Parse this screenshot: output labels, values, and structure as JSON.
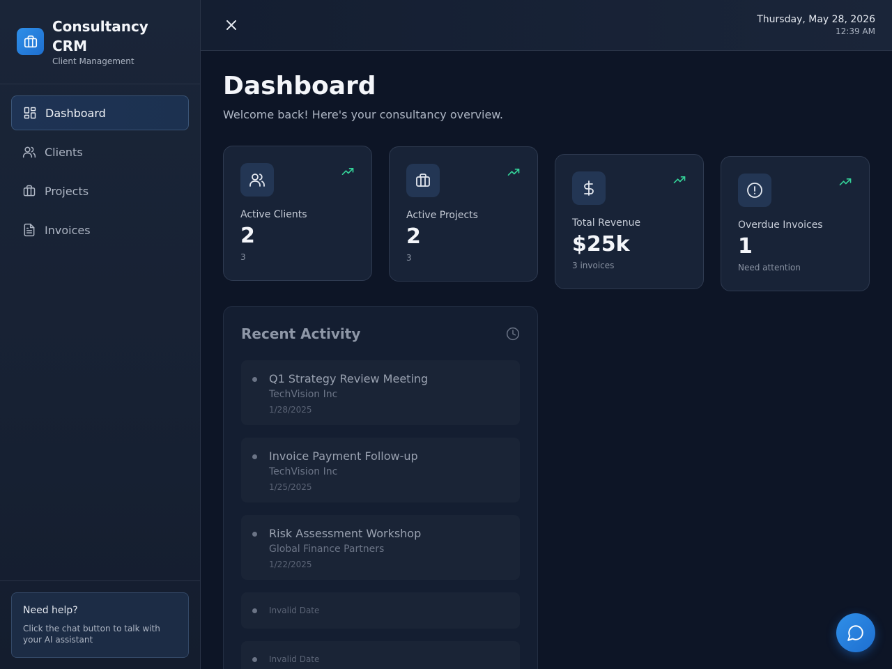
{
  "app": {
    "title": "Consultancy CRM",
    "subtitle": "Client Management",
    "logo_icon": "briefcase-icon"
  },
  "sidebar": {
    "items": [
      {
        "label": "Dashboard",
        "icon": "dashboard-grid-icon",
        "active": true
      },
      {
        "label": "Clients",
        "icon": "users-icon",
        "active": false
      },
      {
        "label": "Projects",
        "icon": "briefcase-icon",
        "active": false
      },
      {
        "label": "Invoices",
        "icon": "file-text-icon",
        "active": false
      }
    ],
    "help": {
      "title": "Need help?",
      "text": "Click the chat button to talk with your AI assistant"
    }
  },
  "header": {
    "date": "Thursday, May 28, 2026",
    "time": "12:39 AM"
  },
  "main": {
    "title": "Dashboard",
    "subtitle": "Welcome back! Here's your consultancy overview.",
    "stats": [
      {
        "label": "Active Clients",
        "value": "2",
        "sub": "3",
        "icon": "users-icon"
      },
      {
        "label": "Active Projects",
        "value": "2",
        "sub": "3",
        "icon": "briefcase-icon"
      },
      {
        "label": "Total Revenue",
        "value": "$25k",
        "sub": "3 invoices",
        "icon": "dollar-icon"
      },
      {
        "label": "Overdue Invoices",
        "value": "1",
        "sub": "Need attention",
        "icon": "alert-circle-icon"
      }
    ],
    "activity": {
      "title": "Recent Activity",
      "items": [
        {
          "name": "Q1 Strategy Review Meeting",
          "client": "TechVision Inc",
          "date": "1/28/2025"
        },
        {
          "name": "Invoice Payment Follow-up",
          "client": "TechVision Inc",
          "date": "1/25/2025"
        },
        {
          "name": "Risk Assessment Workshop",
          "client": "Global Finance Partners",
          "date": "1/22/2025"
        },
        {
          "date": "Invalid Date"
        },
        {
          "date": "Invalid Date"
        }
      ]
    }
  },
  "colors": {
    "accent": "#2f8fe8",
    "trend": "#34d399",
    "background": "#0d1526",
    "sidebar": "#172133"
  }
}
